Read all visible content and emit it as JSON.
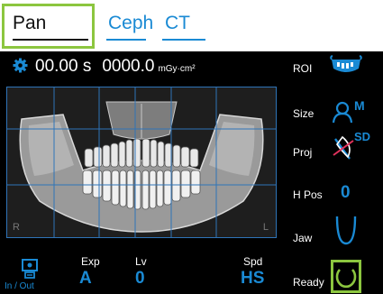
{
  "tabs": [
    {
      "label": "Pan",
      "active": true
    },
    {
      "label": "Ceph",
      "active": false
    },
    {
      "label": "CT",
      "active": false
    }
  ],
  "readout": {
    "time": "00.00 s",
    "dose": "0000.0",
    "dose_unit": "mGy·cm²"
  },
  "panel": {
    "left_letter": "R",
    "right_letter": "L"
  },
  "settings": {
    "roi": {
      "label": "ROI",
      "icon": "full-arch-icon"
    },
    "size": {
      "label": "Size",
      "icon": "medium-patient-icon",
      "badge": "M"
    },
    "proj": {
      "label": "Proj",
      "icon": "projection-sd-icon",
      "badge": "SD"
    },
    "hpos": {
      "label": "H Pos",
      "value": "0"
    },
    "jaw": {
      "label": "Jaw",
      "icon": "jaw-shape-icon"
    }
  },
  "bottom": {
    "inout_label": "In / Out",
    "exp": {
      "label": "Exp",
      "value": "A"
    },
    "lv": {
      "label": "Lv",
      "value": "0"
    },
    "spd": {
      "label": "Spd",
      "value": "HS"
    },
    "ready": {
      "label": "Ready",
      "icon": "ready-ring-icon"
    }
  },
  "colors": {
    "accent": "#1a8ad4",
    "highlight": "#8cc63f",
    "background": "#000000"
  }
}
